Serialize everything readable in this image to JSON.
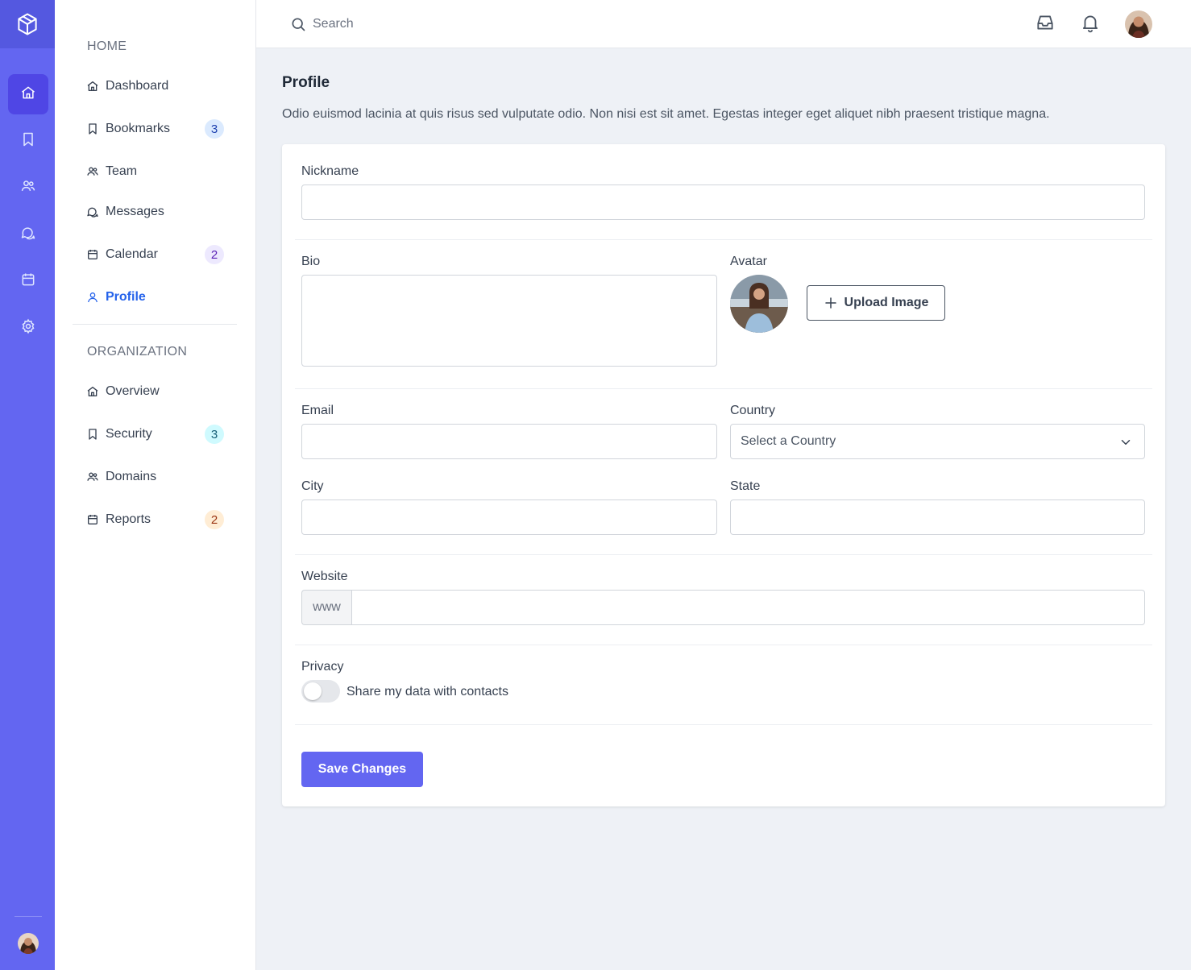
{
  "colors": {
    "rail": "#6366f1",
    "rail_active": "#4f46e5",
    "accent": "#2563eb",
    "primary_button": "#6366f1",
    "page_background": "#eef1f6"
  },
  "rail": {
    "logo_icon": "cube-logo-icon",
    "items": [
      {
        "icon": "home-icon",
        "active": true
      },
      {
        "icon": "bookmark-icon",
        "active": false
      },
      {
        "icon": "users-icon",
        "active": false
      },
      {
        "icon": "chat-icon",
        "active": false
      },
      {
        "icon": "calendar-icon",
        "active": false
      },
      {
        "icon": "gear-icon",
        "active": false
      }
    ]
  },
  "sidebar": {
    "home_section": "HOME",
    "home_items": [
      {
        "label": "Dashboard",
        "icon": "home-icon",
        "badge": null
      },
      {
        "label": "Bookmarks",
        "icon": "bookmark-icon",
        "badge": "3",
        "badge_color": "#dbeafe",
        "badge_text": "#1e40af"
      },
      {
        "label": "Team",
        "icon": "users-icon",
        "badge": null
      },
      {
        "label": "Messages",
        "icon": "chat-icon",
        "badge": null
      },
      {
        "label": "Calendar",
        "icon": "calendar-icon",
        "badge": "2",
        "badge_color": "#ede9fe",
        "badge_text": "#5b21b6"
      },
      {
        "label": "Profile",
        "icon": "user-icon",
        "badge": null,
        "active": true
      }
    ],
    "org_section": "ORGANIZATION",
    "org_items": [
      {
        "label": "Overview",
        "icon": "home-icon",
        "badge": null
      },
      {
        "label": "Security",
        "icon": "bookmark-icon",
        "badge": "3",
        "badge_color": "#cffafe",
        "badge_text": "#155e75"
      },
      {
        "label": "Domains",
        "icon": "users-icon",
        "badge": null
      },
      {
        "label": "Reports",
        "icon": "calendar-icon",
        "badge": "2",
        "badge_color": "#ffedd5",
        "badge_text": "#9a3412"
      }
    ]
  },
  "topbar": {
    "search_placeholder": "Search",
    "icons": [
      "inbox-icon",
      "bell-icon"
    ]
  },
  "main": {
    "title": "Profile",
    "description": "Odio euismod lacinia at quis risus sed vulputate odio. Non nisi est sit amet. Egestas integer eget aliquet nibh praesent tristique magna.",
    "form": {
      "nickname_label": "Nickname",
      "nickname_value": "",
      "bio_label": "Bio",
      "bio_value": "",
      "avatar_label": "Avatar",
      "upload_label": "Upload Image",
      "email_label": "Email",
      "email_value": "",
      "country_label": "Country",
      "country_selected": "Select a Country",
      "city_label": "City",
      "city_value": "",
      "state_label": "State",
      "state_value": "",
      "website_label": "Website",
      "website_prefix": "www",
      "website_value": "",
      "privacy_label": "Privacy",
      "privacy_toggle_label": "Share my data with contacts",
      "privacy_enabled": false,
      "save_label": "Save Changes"
    }
  }
}
